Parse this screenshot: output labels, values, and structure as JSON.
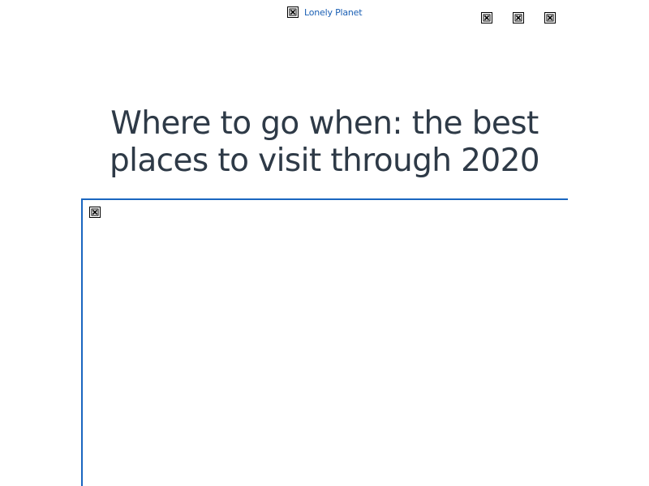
{
  "header": {
    "brand": {
      "label": "Lonely Planet",
      "icon": "broken-image-icon",
      "link_color": "#1a5fb4"
    },
    "icons": [
      {
        "name": "broken-image-icon"
      },
      {
        "name": "broken-image-icon"
      },
      {
        "name": "broken-image-icon"
      }
    ]
  },
  "article": {
    "title": "Where to go when: the best places to visit through 2020",
    "title_color": "#2e3a47",
    "hero_image": {
      "icon": "broken-image-icon",
      "frame_color": "#1a66c0"
    }
  }
}
